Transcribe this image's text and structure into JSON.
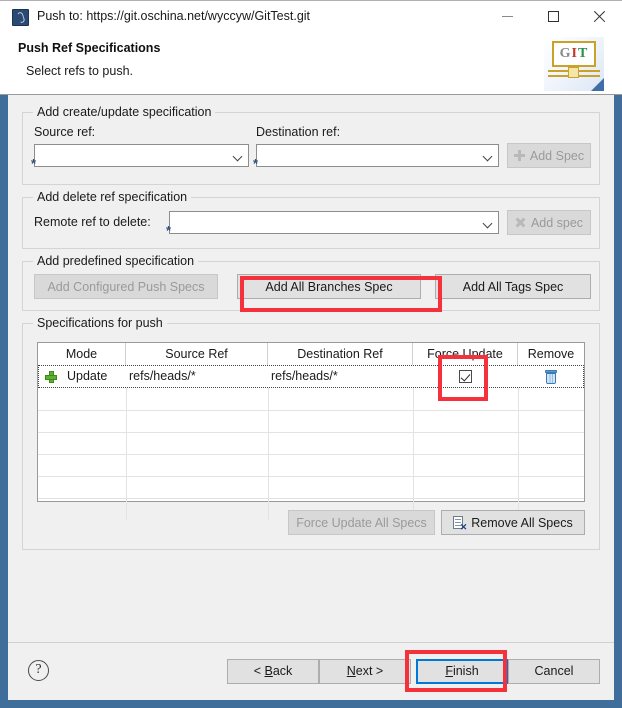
{
  "window": {
    "title": "Push to: https://git.oschina.net/wyccyw/GitTest.git",
    "icon": "push-git-icon",
    "minimize_label": "—",
    "maximize_label": "□",
    "close_label": "✕"
  },
  "header": {
    "title": "Push Ref Specifications",
    "subtitle": "Select refs to push.",
    "logo": {
      "g": "G",
      "i": "I",
      "t": "T"
    }
  },
  "create_update_group": {
    "title": "Add create/update specification",
    "source_ref_label": "Source ref:",
    "destination_ref_label": "Destination ref:",
    "source_ref_value": "",
    "destination_ref_value": "",
    "required_marker": "*",
    "add_spec_button": "Add Spec"
  },
  "delete_group": {
    "title": "Add delete ref specification",
    "remote_ref_label": "Remote ref to delete:",
    "remote_ref_value": "",
    "required_marker": "*",
    "add_spec_button": "Add spec"
  },
  "predefined_group": {
    "title": "Add predefined specification",
    "add_configured_push_specs": "Add Configured Push Specs",
    "add_all_branches_spec": "Add All Branches Spec",
    "add_all_tags_spec": "Add All Tags Spec"
  },
  "specs_group": {
    "title": "Specifications for push",
    "columns": [
      "Mode",
      "Source Ref",
      "Destination Ref",
      "Force Update",
      "Remove"
    ],
    "rows": [
      {
        "mode_icon": "green-plus-icon",
        "mode": "Update",
        "source_ref": "refs/heads/*",
        "destination_ref": "refs/heads/*",
        "force_update": true,
        "remove_icon": "trash-icon"
      }
    ],
    "empty_row_count": 6,
    "force_update_all_button": "Force Update All Specs",
    "remove_all_button": "Remove All Specs"
  },
  "footer": {
    "help_label": "?",
    "back_button": {
      "prefix": "< ",
      "mnemonic": "B",
      "suffix": "ack"
    },
    "next_button": {
      "prefix": "",
      "mnemonic": "N",
      "suffix": "ext >"
    },
    "finish_button": {
      "prefix": "",
      "mnemonic": "F",
      "suffix": "inish"
    },
    "cancel_button": "Cancel"
  },
  "annotations": {
    "accent_red": "#f5323c",
    "focus_blue": "#0078d7",
    "highlighted": [
      "add-all-branches-spec-button",
      "force-update-checkbox",
      "finish-button"
    ]
  }
}
